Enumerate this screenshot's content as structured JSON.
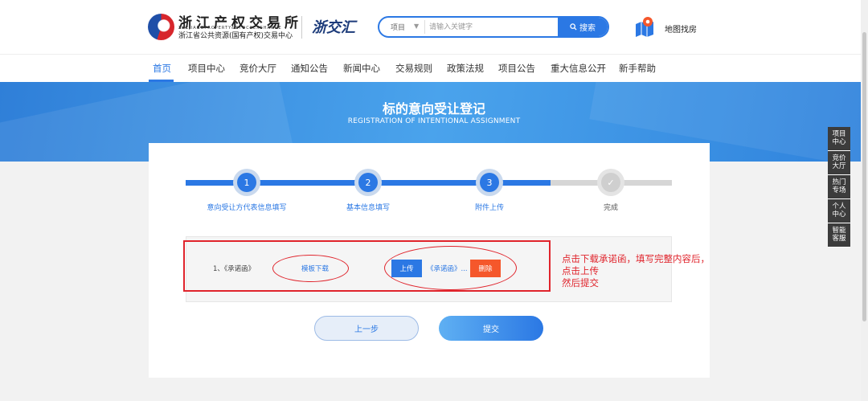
{
  "header": {
    "logo_cn": "浙江产权交易所",
    "logo_en": "ZHEJIANGPROPERTY&STOCKEXCHANGE",
    "logo_sub": "浙江省公共资源(国有产权)交易中心",
    "secondary_logo": "浙交汇",
    "search": {
      "category": "项目",
      "placeholder": "请输入关键字",
      "button_label": "搜索"
    },
    "map_label": "地图找房"
  },
  "nav": {
    "items": [
      {
        "label": "首页",
        "active": true
      },
      {
        "label": "项目中心"
      },
      {
        "label": "竞价大厅"
      },
      {
        "label": "通知公告"
      },
      {
        "label": "新闻中心"
      },
      {
        "label": "交易规则"
      },
      {
        "label": "政策法规"
      },
      {
        "label": "项目公告"
      },
      {
        "label": "重大信息公开"
      },
      {
        "label": "新手帮助"
      }
    ]
  },
  "banner": {
    "title": "标的意向受让登记",
    "subtitle": "REGISTRATION OF INTENTIONAL ASSIGNMENT"
  },
  "steps": [
    {
      "number": "1",
      "label": "意向受让方代表信息填写",
      "status": "done"
    },
    {
      "number": "2",
      "label": "基本信息填写",
      "status": "done"
    },
    {
      "number": "3",
      "label": "附件上传",
      "status": "current"
    },
    {
      "number": "",
      "label": "完成",
      "status": "todo",
      "icon": "check-icon"
    }
  ],
  "attachment": {
    "name": "1、《承诺函》",
    "template_link": "模板下载",
    "upload_label": "上传",
    "uploaded_file": "《承诺函》...",
    "delete_label": "删除"
  },
  "buttons": {
    "prev": "上一步",
    "submit": "提交"
  },
  "annotation": {
    "line1": "点击下载承诺函，填写完整内容后，",
    "line2": "点击上传",
    "line3": "然后提交",
    "color": "#e0242c"
  },
  "side_float": {
    "items": [
      "项目\n中心",
      "竞价\n大厅",
      "热门\n专场",
      "个人\n中心",
      "智能\n客服"
    ]
  },
  "colors": {
    "primary": "#2b78e4",
    "danger": "#f5572b"
  }
}
